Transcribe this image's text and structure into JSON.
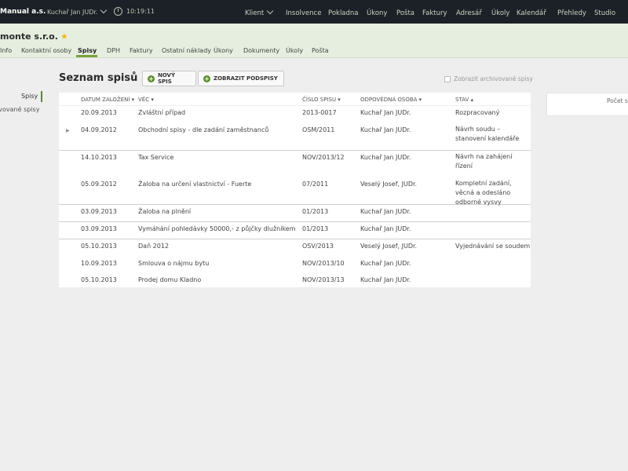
{
  "topbar": {
    "brand": "Manual a.s.",
    "user": "Kuchař Jan JUDr.",
    "timer": "10:19:11",
    "nav": [
      "Klient",
      "Insolvence",
      "Pokladna",
      "Úkony",
      "Pošta",
      "Faktury",
      "Adresář",
      "Úkoly",
      "Kalendář",
      "Přehledy",
      "Studio"
    ]
  },
  "client": {
    "name": "monte s.r.o.",
    "tabs": [
      "Info",
      "Kontaktní osoby",
      "Spisy",
      "DPH",
      "Faktury",
      "Ostatní náklady",
      "Úkony",
      "Dokumenty",
      "Úkoly",
      "Pošta"
    ]
  },
  "sidebar": {
    "active": "Spisy",
    "item": "Archivované spisy"
  },
  "main": {
    "title": "Seznam spisů",
    "new_button": "NOVÝ SPIS",
    "sub_button": "ZOBRAZIT PODSPISY",
    "archive_label": "Zobrazit archivované spisy"
  },
  "table": {
    "headers": [
      "DATUM ZALOŽENÍ ▾",
      "VĚC ▾",
      "ČÍSLO SPISU ▾",
      "ODPOVĚDNÁ OSOBA ▾",
      "STAV ▴"
    ],
    "rows": [
      {
        "date": "20.09.2013",
        "subject": "Zvláštní případ",
        "number": "2013-0017",
        "person": "Kuchař Jan JUDr.",
        "status": "Rozpracovaný"
      },
      {
        "date": "04.09.2012",
        "subject": "Obchodní spisy - dle zadání zaměstnanců",
        "number": "OSM/2011",
        "person": "Kuchař Jan JUDr.",
        "status": "Návrh soudu – stanovení kalendáře"
      },
      {
        "date": "14.10.2013",
        "subject": "Tax Service",
        "number": "NOV/2013/12",
        "person": "Kuchař Jan JUDr.",
        "status": "Návrh na zahájení řízení"
      },
      {
        "date": "05.09.2012",
        "subject": "Žaloba na určení vlastnictví - Fuerte",
        "number": "07/2011",
        "person": "Veselý Josef, JUDr.",
        "status": "Kompletní zadání, věcná a odesláno odborné vysvy"
      },
      {
        "date": "03.09.2013",
        "subject": "Žaloba na plnění",
        "number": "01/2013",
        "person": "Kuchař Jan JUDr.",
        "status": ""
      },
      {
        "date": "03.09.2013",
        "subject": "Vymáhání pohledávky 50000,- z půjčky dlužníkem",
        "number": "01/2013",
        "person": "Kuchař Jan JUDr.",
        "status": ""
      },
      {
        "date": "05.10.2013",
        "subject": "Daň 2012",
        "number": "OSV/2013",
        "person": "Veselý Josef, JUDr.",
        "status": "Vyjednávání se soudem"
      },
      {
        "date": "10.09.2013",
        "subject": "Smlouva o nájmu bytu",
        "number": "NOV/2013/10",
        "person": "Kuchař Jan JUDr.",
        "status": ""
      },
      {
        "date": "05.10.2013",
        "subject": "Prodej domu Kladno",
        "number": "NOV/2013/13",
        "person": "Kuchař Jan JUDr.",
        "status": ""
      }
    ]
  },
  "rightpanel": {
    "label": "Počet spisů"
  }
}
